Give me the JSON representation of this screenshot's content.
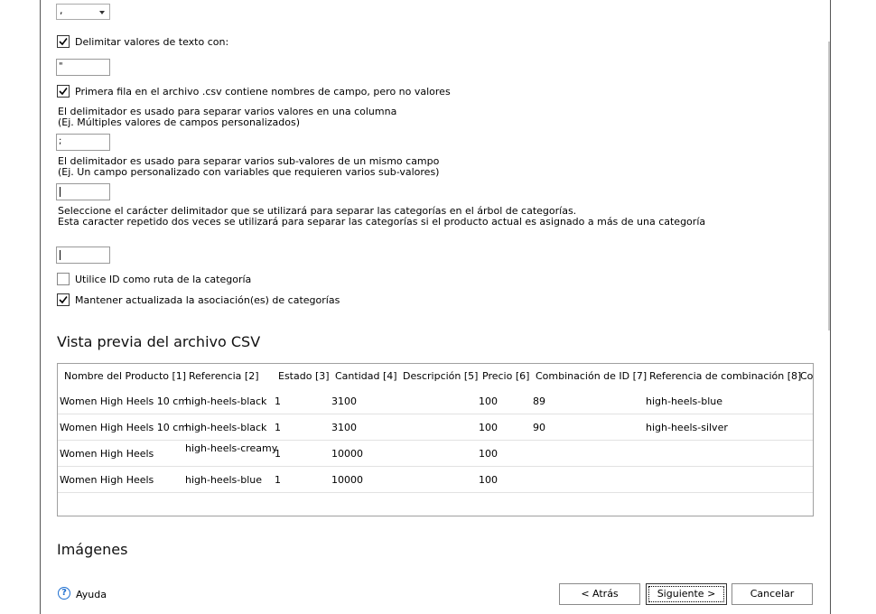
{
  "top_combo": {
    "value": ","
  },
  "options": {
    "delimit_text_label": "Delimitar valores de texto con:",
    "delimit_text_checked": true,
    "delimit_text_value": "\"",
    "first_row_label": "Primera fila en el archivo .csv contiene nombres de campo, pero no valores",
    "first_row_checked": true,
    "multi_value_desc_1": "El delimitador es usado para separar varios valores en una columna",
    "multi_value_desc_2": " (Ej. Múltiples valores de campos personalizados)",
    "multi_value_value": ";",
    "sub_value_desc_1": "El delimitador es usado para separar varios sub-valores de un mismo campo",
    "sub_value_desc_2": " (Ej. Un campo personalizado con variables que requieren varios sub-valores)",
    "sub_value_value": "",
    "category_desc_1": "Seleccione el carácter delimitador que se utilizará para separar las categorías en el árbol de categorías.",
    "category_desc_2": "Esta caracter repetido dos veces se utilizará para separar las categorías si el producto actual es asignado a más de una categoría",
    "category_value": "",
    "use_id_label": "Utilice ID como ruta de la categoría",
    "use_id_checked": false,
    "keep_updated_label": "Mantener actualizada la asociación(es) de categorías",
    "keep_updated_checked": true
  },
  "preview": {
    "title": "Vista previa del archivo CSV",
    "columns": [
      "Nombre del Producto [1]",
      "Referencia [2]",
      "Estado [3]",
      "Cantidad [4]",
      "Descripción [5]",
      "Precio [6]",
      "Combinación de ID [7]",
      "Referencia de combinación [8]",
      "Co"
    ],
    "rows": [
      [
        "Women High Heels 10 cm",
        "high-heels-black",
        "1",
        "3100",
        "",
        "100",
        "89",
        "high-heels-blue"
      ],
      [
        "Women High Heels 10 cm",
        "high-heels-black",
        "1",
        "3100",
        "",
        "100",
        "90",
        "high-heels-silver"
      ],
      [
        "Women High Heels",
        "high-heels-creamy",
        "1",
        "10000",
        "",
        "100",
        "",
        ""
      ],
      [
        "Women High Heels",
        "high-heels-blue",
        "1",
        "10000",
        "",
        "100",
        "",
        ""
      ]
    ]
  },
  "images_section": {
    "title": "Imágenes"
  },
  "footer": {
    "help_label": "Ayuda",
    "back_label": "< Atrás",
    "next_label": "Siguiente >",
    "cancel_label": "Cancelar"
  }
}
